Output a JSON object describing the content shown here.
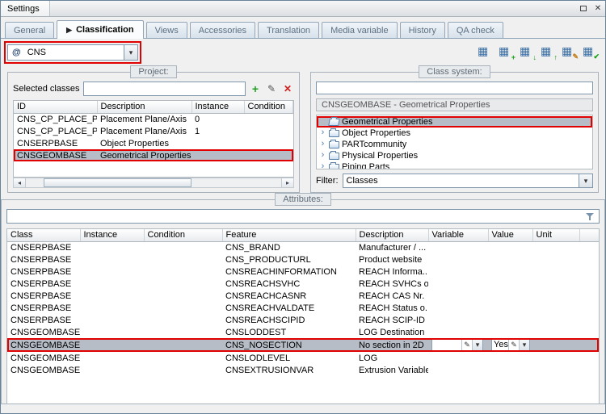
{
  "window": {
    "title": "Settings"
  },
  "annotation_color": "#e10000",
  "selection_color": "#b6bdc6",
  "icons": {
    "float": "▫",
    "close": "✕",
    "tab_arrow": "▶",
    "dropdown": "▾",
    "add": "+",
    "edit": "✎",
    "delete": "✕",
    "expander": "›",
    "scroll_left": "◂",
    "scroll_right": "▸",
    "table_base": "▦",
    "arrow_down": "↓",
    "arrow_up": "↑",
    "check": "✔",
    "pencil": "✎"
  },
  "tabs": [
    {
      "label": "General",
      "active": false
    },
    {
      "label": "Classification",
      "active": true
    },
    {
      "label": "Views",
      "active": false
    },
    {
      "label": "Accessories",
      "active": false
    },
    {
      "label": "Translation",
      "active": false
    },
    {
      "label": "Media variable",
      "active": false
    },
    {
      "label": "History",
      "active": false
    },
    {
      "label": "QA check",
      "active": false
    }
  ],
  "catalog": {
    "prefix": "@",
    "value": "CNS"
  },
  "toolbar": {
    "icons": [
      "table-icon",
      "table-add-icon",
      "table-load-icon",
      "table-save-icon",
      "table-edit-icon",
      "table-check-icon"
    ]
  },
  "project": {
    "title": "Project:",
    "selected_classes_label": "Selected classes",
    "selected_classes_value": "",
    "columns": [
      "ID",
      "Description",
      "Instance",
      "Condition"
    ],
    "rows": [
      {
        "id": "CNS_CP_PLACE_PA",
        "description": "Placement Plane/Axis",
        "instance": "0",
        "condition": "",
        "selected": false
      },
      {
        "id": "CNS_CP_PLACE_PA",
        "description": "Placement Plane/Axis",
        "instance": "1",
        "condition": "",
        "selected": false
      },
      {
        "id": "CNSERPBASE",
        "description": "Object Properties",
        "instance": "",
        "condition": "",
        "selected": false
      },
      {
        "id": "CNSGEOMBASE",
        "description": "Geometrical Properties",
        "instance": "",
        "condition": "",
        "selected": true
      }
    ]
  },
  "class_system": {
    "title": "Class system:",
    "search_value": "",
    "header": "CNSGEOMBASE - Geometrical Properties",
    "tree": [
      {
        "label": "Geometrical Properties",
        "selected": true
      },
      {
        "label": "Object Properties",
        "selected": false
      },
      {
        "label": "PARTcommunity",
        "selected": false
      },
      {
        "label": "Physical Properties",
        "selected": false
      },
      {
        "label": "Piping Parts",
        "selected": false
      }
    ],
    "filter_label": "Filter:",
    "filter_value": "Classes"
  },
  "attributes": {
    "title": "Attributes:",
    "filter_value": "",
    "columns": [
      "Class",
      "Instance",
      "Condition",
      "Feature",
      "Description",
      "Variable",
      "Value",
      "Unit"
    ],
    "rows": [
      {
        "class": "CNSERPBASE",
        "instance": "",
        "condition": "",
        "feature": "CNS_BRAND",
        "description": "Manufacturer / ...",
        "variable": "",
        "value": "",
        "unit": "",
        "selected": false
      },
      {
        "class": "CNSERPBASE",
        "instance": "",
        "condition": "",
        "feature": "CNS_PRODUCTURL",
        "description": "Product website",
        "variable": "",
        "value": "",
        "unit": "",
        "selected": false
      },
      {
        "class": "CNSERPBASE",
        "instance": "",
        "condition": "",
        "feature": "CNSREACHINFORMATION",
        "description": "REACH Informa...",
        "variable": "",
        "value": "",
        "unit": "",
        "selected": false
      },
      {
        "class": "CNSERPBASE",
        "instance": "",
        "condition": "",
        "feature": "CNSREACHSVHC",
        "description": "REACH SVHCs o...",
        "variable": "",
        "value": "",
        "unit": "",
        "selected": false
      },
      {
        "class": "CNSERPBASE",
        "instance": "",
        "condition": "",
        "feature": "CNSREACHCASNR",
        "description": "REACH CAS Nr.",
        "variable": "",
        "value": "",
        "unit": "",
        "selected": false
      },
      {
        "class": "CNSERPBASE",
        "instance": "",
        "condition": "",
        "feature": "CNSREACHVALDATE",
        "description": "REACH Status o...",
        "variable": "",
        "value": "",
        "unit": "",
        "selected": false
      },
      {
        "class": "CNSERPBASE",
        "instance": "",
        "condition": "",
        "feature": "CNSREACHSCIPID",
        "description": "REACH SCIP-ID",
        "variable": "",
        "value": "",
        "unit": "",
        "selected": false
      },
      {
        "class": "CNSGEOMBASE",
        "instance": "",
        "condition": "",
        "feature": "CNSLODDEST",
        "description": "LOG Destination",
        "variable": "",
        "value": "",
        "unit": "",
        "selected": false
      },
      {
        "class": "CNSGEOMBASE",
        "instance": "",
        "condition": "",
        "feature": "CNS_NOSECTION",
        "description": "No section in 2D",
        "variable": "",
        "value": "Yes",
        "unit": "",
        "selected": true,
        "editors": true
      },
      {
        "class": "CNSGEOMBASE",
        "instance": "",
        "condition": "",
        "feature": "CNSLODLEVEL",
        "description": "LOG",
        "variable": "",
        "value": "",
        "unit": "",
        "selected": false
      },
      {
        "class": "CNSGEOMBASE",
        "instance": "",
        "condition": "",
        "feature": "CNSEXTRUSIONVAR",
        "description": "Extrusion Variable",
        "variable": "",
        "value": "",
        "unit": "",
        "selected": false
      }
    ]
  }
}
